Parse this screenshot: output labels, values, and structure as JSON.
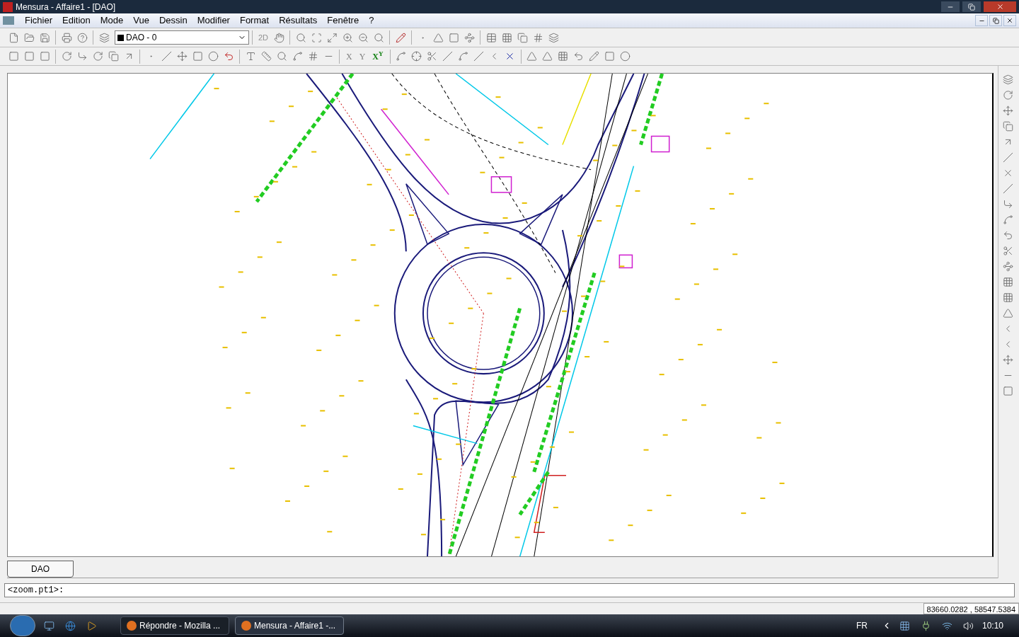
{
  "window": {
    "title": "Mensura - Affaire1 - [DAO]"
  },
  "menu": [
    "Fichier",
    "Edition",
    "Mode",
    "Vue",
    "Dessin",
    "Modifier",
    "Format",
    "Résultats",
    "Fenêtre",
    "?"
  ],
  "toolbar": {
    "layer_select": {
      "value": "DAO - 0"
    },
    "view_mode": "2D",
    "axis_labels": [
      "X",
      "Y",
      "X$^{Y}$"
    ]
  },
  "tabs": [
    {
      "label": "DAO",
      "selected": true
    }
  ],
  "command_line": {
    "value": "<zoom.pt1>: "
  },
  "status_bar": {
    "coordinates": "83660.0282 , 58547.5384"
  },
  "taskbar": {
    "items": [
      {
        "label": "Répondre - Mozilla ...",
        "selected": false
      },
      {
        "label": "Mensura - Affaire1 -...",
        "selected": true
      }
    ],
    "language": "FR",
    "clock": "10:10"
  }
}
